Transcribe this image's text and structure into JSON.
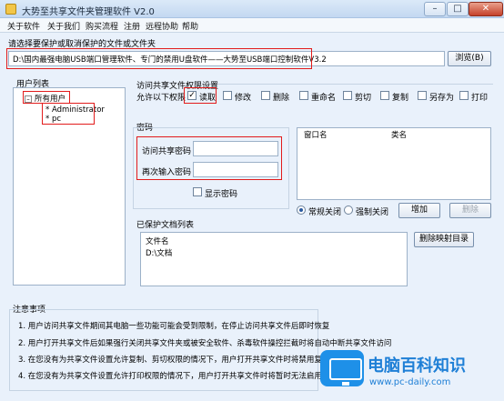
{
  "window": {
    "title": "大势至共享文件夹管理软件 V2.0",
    "minimize": "–",
    "maximize": "□",
    "close": "✕"
  },
  "menu": [
    "关于软件",
    "关于我们",
    "购买流程",
    "注册",
    "远程协助",
    "帮助"
  ],
  "path_section": {
    "label": "请选择要保护或取消保护的文件或文件夹",
    "path_value": "D:\\国内最强电脑USB端口管理软件、专门的禁用U盘软件——大势至USB端口控制软件V3.2",
    "browse_button": "浏览(B)"
  },
  "user_list": {
    "label": "用户列表",
    "root": "所有用户",
    "users": [
      "Administrator",
      "pc"
    ]
  },
  "permissions": {
    "label": "访问共享文件权限设置",
    "allow_label": "允许以下权限",
    "items": [
      {
        "label": "读取",
        "checked": true
      },
      {
        "label": "修改",
        "checked": false
      },
      {
        "label": "删除",
        "checked": false
      },
      {
        "label": "重命名",
        "checked": false
      },
      {
        "label": "剪切",
        "checked": false
      },
      {
        "label": "复制",
        "checked": false
      },
      {
        "label": "另存为",
        "checked": false
      },
      {
        "label": "打印",
        "checked": false
      }
    ]
  },
  "password": {
    "label": "密码",
    "access_label": "访问共享密码",
    "confirm_label": "再次输入密码",
    "show_password": "显示密码"
  },
  "window_table": {
    "col_window": "窗口名",
    "col_class": "类名"
  },
  "close_mode": {
    "normal": "常规关闭",
    "force": "强制关闭",
    "add_button": "增加",
    "delete_button": "删除"
  },
  "protected": {
    "label": "已保护文档列表",
    "header": "文件名",
    "items": [
      "D:\\文档"
    ],
    "delete_mapping_button": "删除映射目录"
  },
  "notes": {
    "label": "注意事项",
    "lines": [
      "1. 用户访问共享文件期间其电脑一些功能可能会受到限制，在停止访问共享文件后即时恢复",
      "2. 用户打开共享文件后如果强行关闭共享文件夹或被安全软件、杀毒软件操控拦截时将自动中断共享文件访问",
      "3. 在您没有为共享文件设置允许复制、剪切权限的情况下，用户打开共享文件时将禁用复制热键",
      "4. 在您没有为共享文件设置允许打印权限的情况下，用户打开共享文件时将暂时无法启用打印"
    ]
  },
  "watermark": {
    "title": "电脑百科知识",
    "url": "www.pc-daily.com"
  },
  "colors": {
    "accent": "#1e90e8",
    "highlight": "#e21b1b"
  }
}
